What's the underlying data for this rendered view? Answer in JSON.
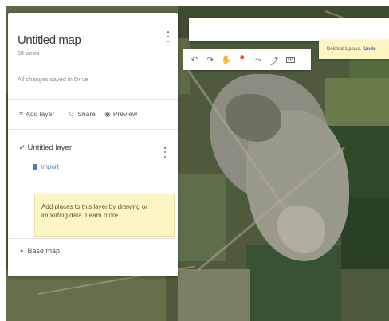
{
  "map": {
    "title": "Untitled map",
    "views": "58 views",
    "save_status": "All changes saved in Drive",
    "more_menu_icon": "more-vert-icon"
  },
  "actions": {
    "add_layer": "Add layer",
    "share": "Share",
    "preview": "Preview"
  },
  "layer": {
    "title": "Untitled layer",
    "import": "Import",
    "tip_text": "Add places to this layer by drawing or importing data.",
    "tip_link": "Learn more"
  },
  "base_map": {
    "label": "Base map"
  },
  "toolbar": {
    "buttons": [
      "undo",
      "redo",
      "pan",
      "add-marker",
      "draw-line",
      "add-directions",
      "measure"
    ]
  },
  "toast": {
    "text": "Deleted 1 place.",
    "link": "Undo"
  },
  "colors": {
    "tip_background": "#fdf5c4",
    "link": "#4a7bd0"
  }
}
